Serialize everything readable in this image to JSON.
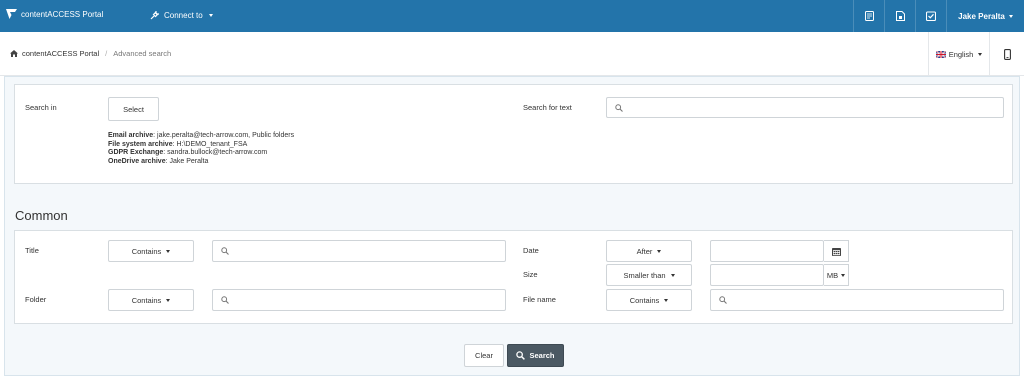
{
  "navbar": {
    "brand": "contentACCESS Portal",
    "connect_label": "Connect to",
    "icons": [
      "report-icon",
      "document-icon",
      "checklist-icon"
    ],
    "user": "Jake Peralta",
    "bg_color": "#2374aa"
  },
  "breadcrumb": {
    "home": "contentACCESS Portal",
    "current": "Advanced search"
  },
  "language": "English",
  "search_in": {
    "label": "Search in",
    "select_label": "Select",
    "archives": [
      {
        "name": "Email archive",
        "value": "jake.peralta@tech-arrow.com, Public folders"
      },
      {
        "name": "File system archive",
        "value": "H:\\DEMO_tenant_FSA"
      },
      {
        "name": "GDPR Exchange",
        "value": "sandra.bullock@tech-arrow.com"
      },
      {
        "name": "OneDrive archive",
        "value": "Jake Peralta"
      }
    ]
  },
  "search_text": {
    "label": "Search for text",
    "value": ""
  },
  "common": {
    "title": "Common",
    "title_field": {
      "label": "Title",
      "operator": "Contains",
      "value": ""
    },
    "folder_field": {
      "label": "Folder",
      "operator": "Contains",
      "value": ""
    },
    "date_field": {
      "label": "Date",
      "operator": "After",
      "value": ""
    },
    "size_field": {
      "label": "Size",
      "operator": "Smaller than",
      "value": "",
      "unit": "MB"
    },
    "filename_field": {
      "label": "File name",
      "operator": "Contains",
      "value": ""
    }
  },
  "actions": {
    "clear": "Clear",
    "search": "Search"
  },
  "colors": {
    "search_button": "#4b5963",
    "page_bg": "#f4f8fb"
  }
}
